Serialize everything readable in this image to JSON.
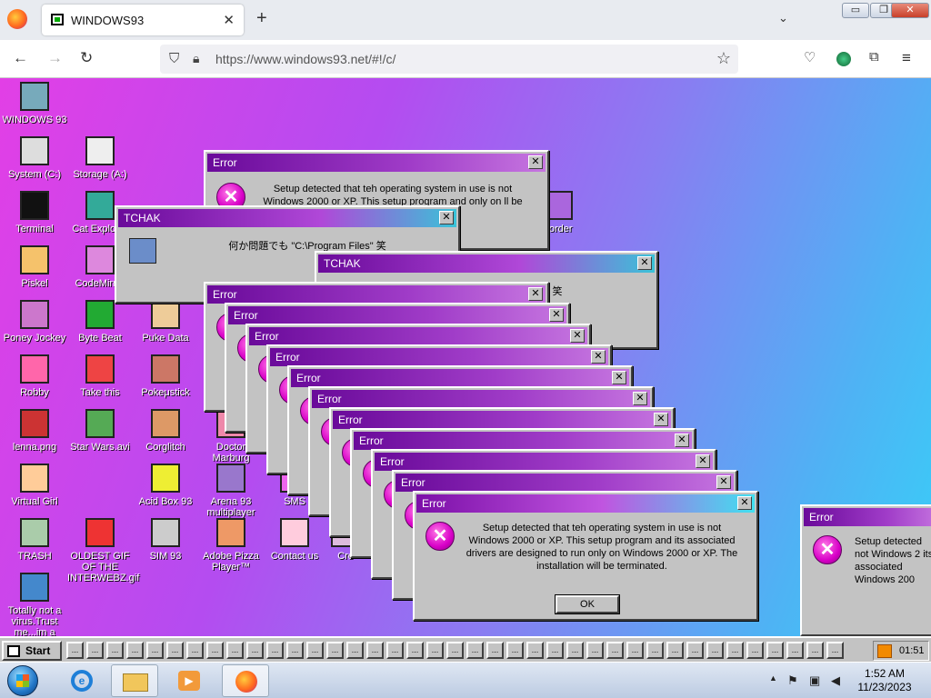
{
  "browser": {
    "tab_title": "WINDOWS93",
    "tab_close": "✕",
    "new_tab": "+",
    "tab_list": "⌄",
    "url": "https://www.windows93.net/#!/c/",
    "win_buttons": {
      "minimize": "▭",
      "maximize": "❐",
      "close": "✕"
    },
    "nav": {
      "back": "←",
      "forward": "→",
      "reload": "↻"
    }
  },
  "desktop_icons": [
    {
      "label": "WINDOWS 93",
      "icon": "computer-icon"
    },
    {
      "label": "System (C:)",
      "icon": "drive-icon"
    },
    {
      "label": "Storage (A:)",
      "icon": "floppy-drive-icon"
    },
    {
      "label": "Terminal",
      "icon": "terminal-icon"
    },
    {
      "label": "Cat Explorer",
      "icon": "cat-explorer-icon"
    },
    {
      "label": "Piskel",
      "icon": "palette-icon"
    },
    {
      "label": "CodeMirror",
      "icon": "codemirror-icon"
    },
    {
      "label": "Poney Jockey",
      "icon": "pony-icon"
    },
    {
      "label": "Byte Beat",
      "icon": "bytebeat-icon"
    },
    {
      "label": "Puke Data",
      "icon": "puke-data-icon"
    },
    {
      "label": "Robby",
      "icon": "robby-icon"
    },
    {
      "label": "Take this",
      "icon": "take-this-icon"
    },
    {
      "label": "Pokeμstick",
      "icon": "poke-icon"
    },
    {
      "label": "lenna.png",
      "icon": "image-file-icon"
    },
    {
      "label": "Star Wars.avi",
      "icon": "yoda-icon"
    },
    {
      "label": "Corglitch",
      "icon": "corgi-icon"
    },
    {
      "label": "Doctor Marburg",
      "icon": "doctor-icon"
    },
    {
      "label": "Virtual Girl",
      "icon": "virtual-girl-icon"
    },
    {
      "label": "Acid Box 93",
      "icon": "smiley-icon"
    },
    {
      "label": "Arena 93 multiplayer",
      "icon": "cube-icon"
    },
    {
      "label": "SMS",
      "icon": "sms-icon"
    },
    {
      "label": "TRASH",
      "icon": "trash-icon"
    },
    {
      "label": "OLDEST GIF OF THE INTERWEBZ.gif",
      "icon": "gif-file-icon"
    },
    {
      "label": "SIM 93",
      "icon": "sim-icon"
    },
    {
      "label": "Adobe Pizza Player™",
      "icon": "pizza-icon"
    },
    {
      "label": "Contact us",
      "icon": "contact-icon"
    },
    {
      "label": "Cre",
      "icon": "create-icon"
    },
    {
      "label": "Totally not a virus.Trust me...im a",
      "icon": "dolphin-icon"
    },
    {
      "label": "corder",
      "icon": "recorder-icon"
    }
  ],
  "tchak_windows": [
    {
      "title": "TCHAK",
      "text": "何か問題でも \"C:\\Program Files\" 笑"
    },
    {
      "title": "TCHAK",
      "text": "笑"
    }
  ],
  "stacked_errors": [
    {
      "title": "Error"
    },
    {
      "title": "Error"
    },
    {
      "title": "Error"
    },
    {
      "title": "Error"
    },
    {
      "title": "Error"
    },
    {
      "title": "Error"
    },
    {
      "title": "Error"
    },
    {
      "title": "Error"
    },
    {
      "title": "Error"
    },
    {
      "title": "Error"
    }
  ],
  "top_error": {
    "title": "Error",
    "message": "Setup detected that teh operating system in use is not Windows 2000 or XP. This setup program and its associated drivers are designed to run only on Windows 2000 or XP. The installation will be terminated.",
    "message_partial": "Setup detected that teh operating system in use is not Windows 2000 or XP. This setup program and only on ll be"
  },
  "front_error": {
    "title": "Error",
    "message": "Setup detected that teh operating system in use is not Windows 2000 or XP. This setup program and its associated drivers are designed to run only on Windows 2000 or XP. The installation will be terminated.",
    "ok_label": "OK",
    "close": "✕"
  },
  "right_error": {
    "title": "Error",
    "message": "Setup detected not Windows 2 its associated Windows 200"
  },
  "taskbar93": {
    "start_label": "Start",
    "slot_count": 39,
    "slot_label": "...",
    "clock": "01:51"
  },
  "win7_taskbar": {
    "time": "1:52 AM",
    "date": "11/23/2023",
    "tray_up": "▲"
  }
}
